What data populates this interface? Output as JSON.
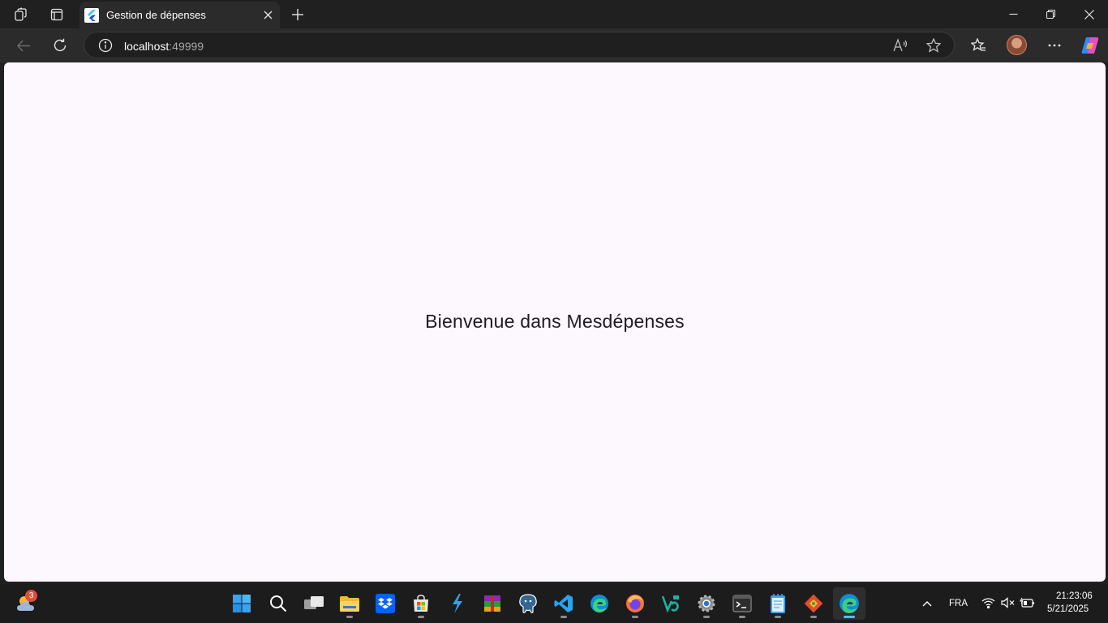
{
  "browser": {
    "tab_title": "Gestion de dépenses",
    "address_host": "localhost",
    "address_port": ":49999"
  },
  "page": {
    "welcome_text": "Bienvenue dans Mesdépenses"
  },
  "taskbar": {
    "weather_badge": "3",
    "language": "FRA",
    "time": "21:23:06",
    "date": "5/21/2025",
    "apps": [
      "start",
      "search",
      "task-view",
      "file-explorer",
      "dropbox",
      "microsoft-store",
      "visual-studio",
      "winrar",
      "postgresql",
      "vscode",
      "edge",
      "firefox",
      "vs-code-alt",
      "settings",
      "terminal",
      "notepad",
      "git",
      "edge-active"
    ]
  },
  "colors": {
    "page_background": "#fdf7fe",
    "chrome_dark": "#202020",
    "toolbar": "#2b2b2b",
    "accent": "#4cc2ff"
  }
}
